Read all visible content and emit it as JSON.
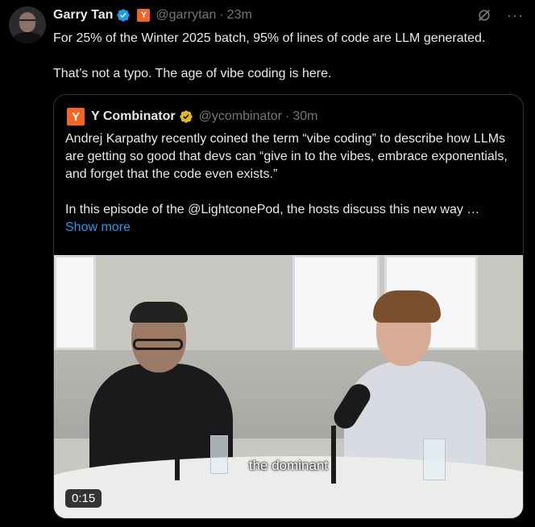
{
  "tweet": {
    "author_name": "Garry Tan",
    "badge_letter": "Y",
    "handle": "@garrytan",
    "separator": "·",
    "time": "23m",
    "text_line1": "For 25% of the Winter 2025 batch, 95% of lines of code are LLM generated.",
    "text_line2": "That’s not a typo. The age of vibe coding is here."
  },
  "icons": {
    "grok": "grok-slash-icon",
    "more": "more-dots-icon",
    "verified": "blue-verified-icon",
    "gold": "gold-verified-icon"
  },
  "colors": {
    "accent": "#1d9bf0",
    "yc_orange": "#f26522",
    "gold": "#e2b719",
    "muted": "#71767b"
  },
  "quote": {
    "logo_letter": "Y",
    "author_name": "Y Combinator",
    "handle": "@ycombinator",
    "separator": "·",
    "time": "30m",
    "para1": "Andrej Karpathy recently coined the term “vibe coding” to describe how LLMs are getting so good that devs can “give in to the vibes, embrace exponentials, and forget that the code even exists.”",
    "para2": "In this episode of the @LightconePod, the hosts discuss this new way …",
    "show_more": "Show more"
  },
  "video": {
    "caption": "the dominant",
    "timestamp": "0:15"
  }
}
